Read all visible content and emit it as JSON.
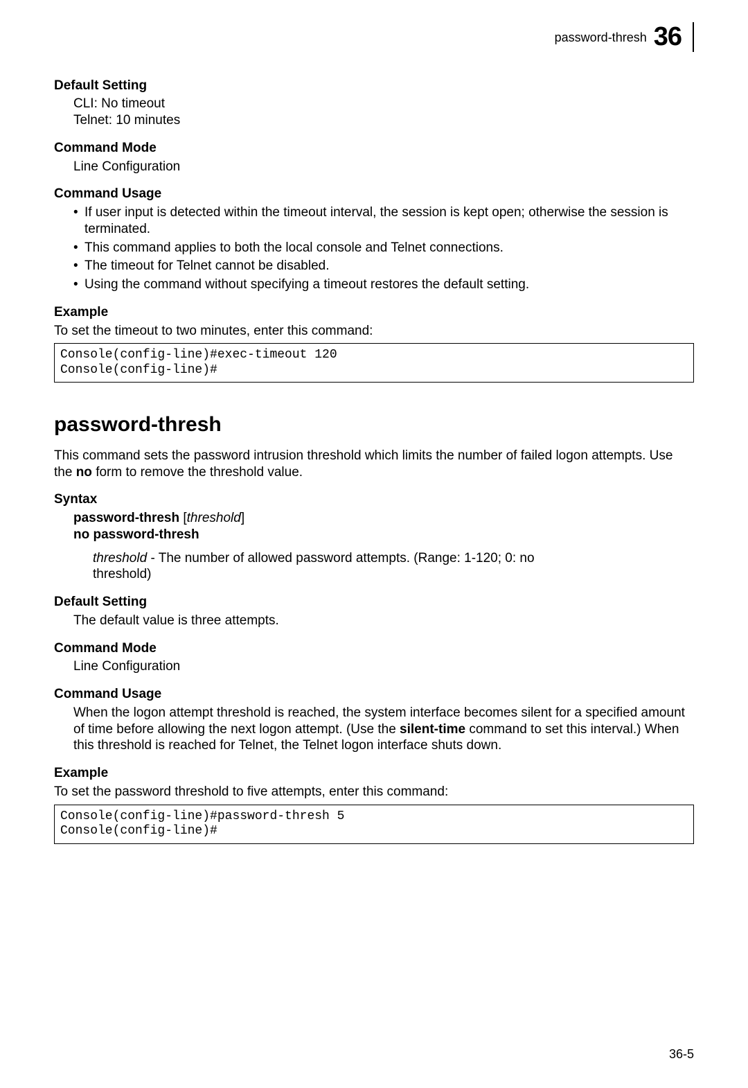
{
  "header": {
    "running": "password-thresh",
    "chapter": "36"
  },
  "sec1": {
    "default_head": "Default Setting",
    "default_l1": "CLI: No timeout",
    "default_l2": "Telnet: 10 minutes",
    "mode_head": "Command Mode",
    "mode_body": "Line Configuration",
    "usage_head": "Command Usage",
    "usage_b1": "If user input is detected within the timeout interval, the session is kept open; otherwise the session is terminated.",
    "usage_b2": "This command applies to both the local console and Telnet connections.",
    "usage_b3": "The timeout for Telnet cannot be disabled.",
    "usage_b4": "Using the command without specifying a timeout restores the default setting.",
    "example_head": "Example",
    "example_intro": "To set the timeout to two minutes, enter this command:",
    "example_code": "Console(config-line)#exec-timeout 120\nConsole(config-line)#"
  },
  "cmd": {
    "title": "password-thresh",
    "desc_a": "This command sets the password intrusion threshold which limits the number of failed logon attempts. Use the ",
    "desc_no": "no",
    "desc_b": " form to remove the threshold value.",
    "syntax_head": "Syntax",
    "syntax_b1": "password-thresh",
    "syntax_b1_arg": "threshold",
    "syntax_b2": "no password-thresh",
    "arg_name": "threshold",
    "arg_desc": " - The number of allowed password attempts. (Range: 1-120; 0: no threshold)",
    "default_head": "Default Setting",
    "default_body": "The default value is three attempts.",
    "mode_head": "Command Mode",
    "mode_body": "Line Configuration",
    "usage_head": "Command Usage",
    "usage_a": "When the logon attempt threshold is reached, the system interface becomes silent for a specified amount of time before allowing the next logon attempt. (Use the ",
    "usage_st": "silent-time",
    "usage_b": " command to set this interval.) When this threshold is reached for Telnet, the Telnet logon interface shuts down.",
    "example_head": "Example",
    "example_intro": "To set the password threshold to five attempts, enter this command:",
    "example_code": "Console(config-line)#password-thresh 5\nConsole(config-line)#"
  },
  "pagenum": "36-5"
}
